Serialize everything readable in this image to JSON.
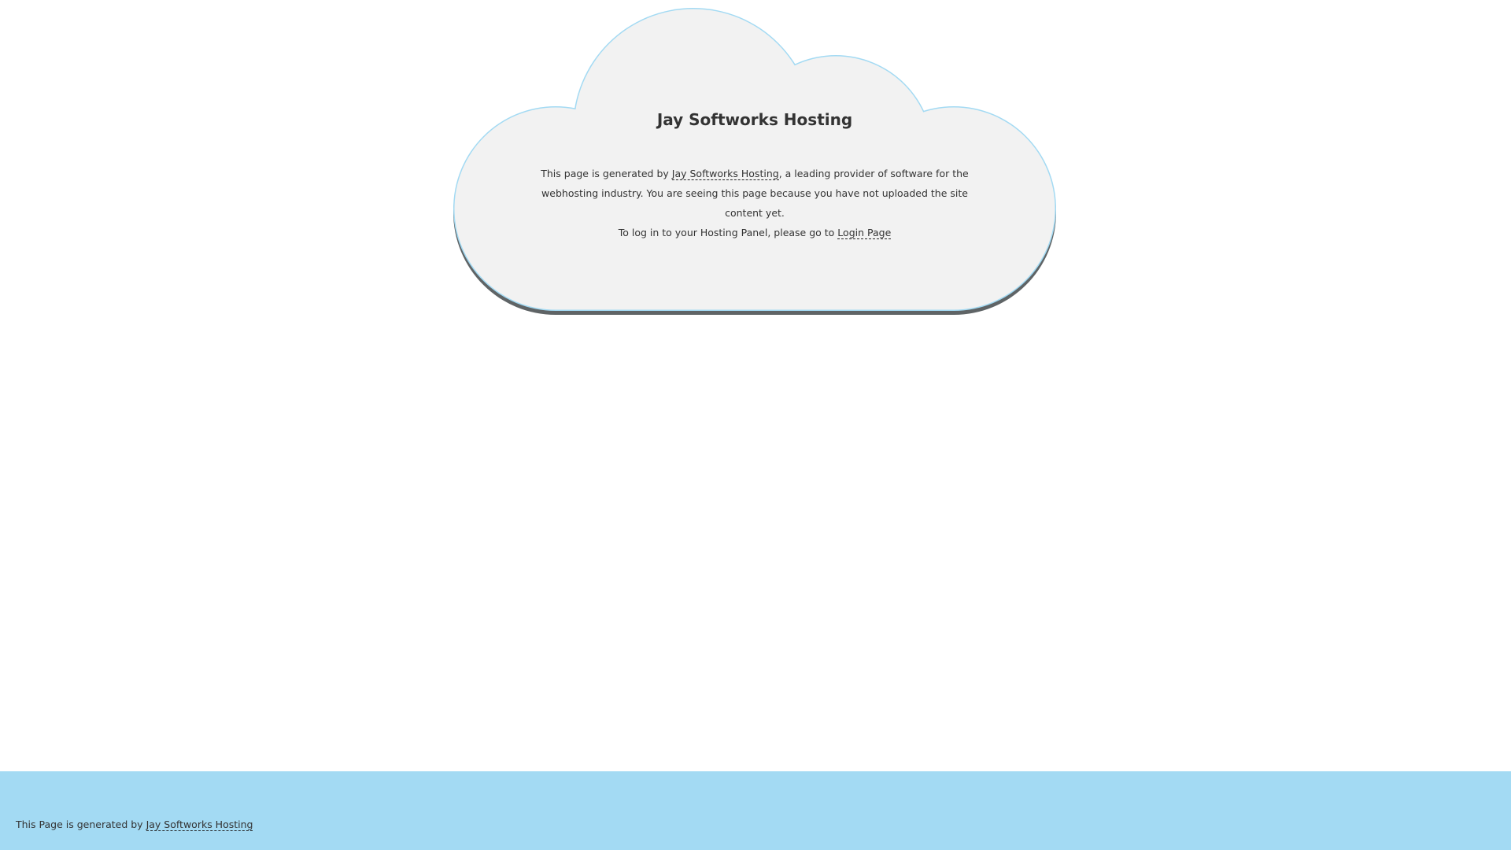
{
  "cloud": {
    "title": "Jay Softworks Hosting",
    "line1_pre": "This page is generated by ",
    "line1_link": "Jay Softworks Hosting",
    "line1_post": ", a leading provider of software for the webhosting industry. You are seeing this page because you have not uploaded the site content yet.",
    "line2_pre": "To log in to your Hosting Panel, please go to ",
    "line2_link": "Login Page"
  },
  "footer": {
    "text_pre": "This Page is generated by ",
    "link": "Jay Softworks Hosting"
  },
  "colors": {
    "cloud_fill": "#f2f2f2",
    "cloud_border": "#a3daf3",
    "cloud_shadow": "#5f6466",
    "footer_bg": "#a3daf3",
    "text": "#333333"
  }
}
